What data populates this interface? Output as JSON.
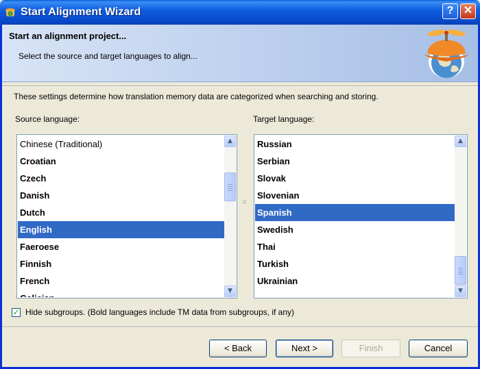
{
  "window": {
    "title": "Start Alignment Wizard",
    "help_label": "?",
    "close_label": "✕"
  },
  "header": {
    "title": "Start an alignment project...",
    "subtitle": "Select the source and target languages to align..."
  },
  "description": "These settings determine how translation memory data are categorized when searching and storing.",
  "source": {
    "label": "Source language:",
    "items": [
      {
        "label": "Chinese (Traditional)",
        "bold": false,
        "selected": false
      },
      {
        "label": "Croatian",
        "bold": true,
        "selected": false
      },
      {
        "label": "Czech",
        "bold": true,
        "selected": false
      },
      {
        "label": "Danish",
        "bold": true,
        "selected": false
      },
      {
        "label": "Dutch",
        "bold": true,
        "selected": false
      },
      {
        "label": "English",
        "bold": true,
        "selected": true
      },
      {
        "label": "Faeroese",
        "bold": true,
        "selected": false
      },
      {
        "label": "Finnish",
        "bold": true,
        "selected": false
      },
      {
        "label": "French",
        "bold": true,
        "selected": false
      },
      {
        "label": "Galician",
        "bold": true,
        "selected": false
      }
    ]
  },
  "target": {
    "label": "Target language:",
    "items": [
      {
        "label": "Russian",
        "bold": true,
        "selected": false
      },
      {
        "label": "Serbian",
        "bold": true,
        "selected": false
      },
      {
        "label": "Slovak",
        "bold": true,
        "selected": false
      },
      {
        "label": "Slovenian",
        "bold": true,
        "selected": false
      },
      {
        "label": "Spanish",
        "bold": true,
        "selected": true
      },
      {
        "label": "Swedish",
        "bold": true,
        "selected": false
      },
      {
        "label": "Thai",
        "bold": true,
        "selected": false
      },
      {
        "label": "Turkish",
        "bold": true,
        "selected": false
      },
      {
        "label": "Ukrainian",
        "bold": true,
        "selected": false
      }
    ]
  },
  "hide_subgroups": {
    "checked": true,
    "label": "Hide subgroups. (Bold languages include TM data from subgroups, if any)"
  },
  "buttons": {
    "back": "< Back",
    "next": "Next >",
    "finish": "Finish",
    "cancel": "Cancel"
  },
  "scroll_arrows": {
    "up": "▲",
    "down": "▼"
  }
}
